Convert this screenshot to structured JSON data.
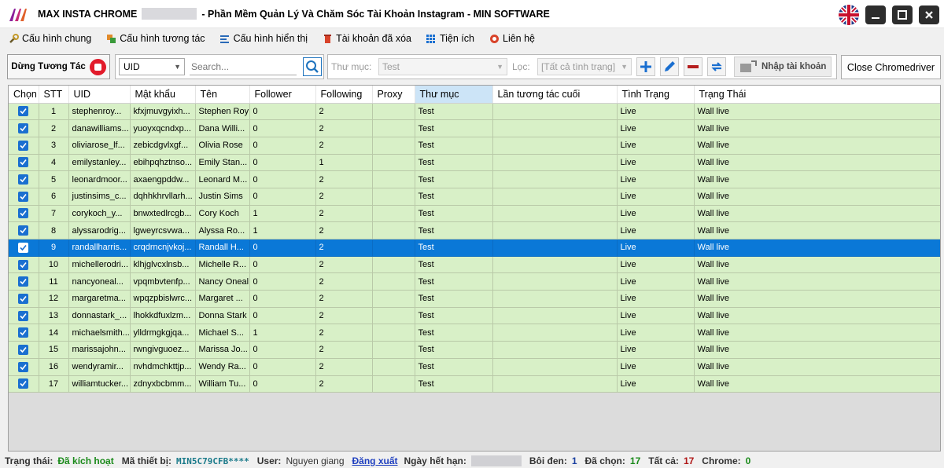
{
  "window": {
    "title_prefix": "MAX INSTA CHROME",
    "title_suffix": "- Phần Mềm Quản Lý Và Chăm Sóc Tài Khoản Instagram - MIN SOFTWARE"
  },
  "menu": {
    "items": [
      {
        "label": "Cấu hình chung",
        "icon": "wrench-icon"
      },
      {
        "label": "Cấu hình tương tác",
        "icon": "interaction-icon"
      },
      {
        "label": "Cấu hình hiển thị",
        "icon": "display-icon"
      },
      {
        "label": "Tài khoản đã xóa",
        "icon": "trash-icon"
      },
      {
        "label": "Tiện ích",
        "icon": "grid-icon"
      },
      {
        "label": "Liên hệ",
        "icon": "contact-icon"
      }
    ]
  },
  "toolbar": {
    "stop_label": "Dừng Tương Tác",
    "search_field_value": "UID",
    "search_placeholder": "Search...",
    "folder_label": "Thư mục:",
    "folder_value": "Test",
    "filter_label": "Lọc:",
    "filter_value": "[Tất cả tình trạng]",
    "import_label": "Nhập tài khoản",
    "close_driver_label": "Close Chromedriver"
  },
  "table": {
    "columns": [
      "Chọn",
      "STT",
      "UID",
      "Mật khẩu",
      "Tên",
      "Follower",
      "Following",
      "Proxy",
      "Thư mục",
      "Lần tương tác cuối",
      "Tình Trạng",
      "Trạng Thái"
    ],
    "selected_row_index": 8,
    "rows": [
      {
        "stt": "1",
        "uid": "stephenroy...",
        "pass": "kfxjmuvgyixh...",
        "name": "Stephen Roy",
        "follower": "0",
        "following": "2",
        "proxy": "",
        "folder": "Test",
        "last": "",
        "status": "Live",
        "state": "Wall live"
      },
      {
        "stt": "2",
        "uid": "danawilliams...",
        "pass": "yuoyxqcndxp...",
        "name": "Dana Willi...",
        "follower": "0",
        "following": "2",
        "proxy": "",
        "folder": "Test",
        "last": "",
        "status": "Live",
        "state": "Wall live"
      },
      {
        "stt": "3",
        "uid": "oliviarose_lf...",
        "pass": "zebicdgvlxgf...",
        "name": "Olivia Rose",
        "follower": "0",
        "following": "2",
        "proxy": "",
        "folder": "Test",
        "last": "",
        "status": "Live",
        "state": "Wall live"
      },
      {
        "stt": "4",
        "uid": "emilystanley...",
        "pass": "ebihpqhztnso...",
        "name": "Emily Stan...",
        "follower": "0",
        "following": "1",
        "proxy": "",
        "folder": "Test",
        "last": "",
        "status": "Live",
        "state": "Wall live"
      },
      {
        "stt": "5",
        "uid": "leonardmoor...",
        "pass": "axaengpddw...",
        "name": "Leonard M...",
        "follower": "0",
        "following": "2",
        "proxy": "",
        "folder": "Test",
        "last": "",
        "status": "Live",
        "state": "Wall live"
      },
      {
        "stt": "6",
        "uid": "justinsims_c...",
        "pass": "dqhhkhrvllarh...",
        "name": "Justin Sims",
        "follower": "0",
        "following": "2",
        "proxy": "",
        "folder": "Test",
        "last": "",
        "status": "Live",
        "state": "Wall live"
      },
      {
        "stt": "7",
        "uid": "corykoch_y...",
        "pass": "bnwxtedlrcgb...",
        "name": "Cory Koch",
        "follower": "1",
        "following": "2",
        "proxy": "",
        "folder": "Test",
        "last": "",
        "status": "Live",
        "state": "Wall live"
      },
      {
        "stt": "8",
        "uid": "alyssarodrig...",
        "pass": "lgweyrcsvwa...",
        "name": "Alyssa Ro...",
        "follower": "1",
        "following": "2",
        "proxy": "",
        "folder": "Test",
        "last": "",
        "status": "Live",
        "state": "Wall live"
      },
      {
        "stt": "9",
        "uid": "randallharris...",
        "pass": "crqdrncnjvkoj...",
        "name": "Randall H...",
        "follower": "0",
        "following": "2",
        "proxy": "",
        "folder": "Test",
        "last": "",
        "status": "Live",
        "state": "Wall live"
      },
      {
        "stt": "10",
        "uid": "michellerodri...",
        "pass": "klhjglvcxlnsb...",
        "name": "Michelle R...",
        "follower": "0",
        "following": "2",
        "proxy": "",
        "folder": "Test",
        "last": "",
        "status": "Live",
        "state": "Wall live"
      },
      {
        "stt": "11",
        "uid": "nancyoneal...",
        "pass": "vpqmbvtenfp...",
        "name": "Nancy Oneal",
        "follower": "0",
        "following": "2",
        "proxy": "",
        "folder": "Test",
        "last": "",
        "status": "Live",
        "state": "Wall live"
      },
      {
        "stt": "12",
        "uid": "margaretma...",
        "pass": "wpqzpbislwrc...",
        "name": "Margaret ...",
        "follower": "0",
        "following": "2",
        "proxy": "",
        "folder": "Test",
        "last": "",
        "status": "Live",
        "state": "Wall live"
      },
      {
        "stt": "13",
        "uid": "donnastark_...",
        "pass": "lhokkdfuxlzm...",
        "name": "Donna Stark",
        "follower": "0",
        "following": "2",
        "proxy": "",
        "folder": "Test",
        "last": "",
        "status": "Live",
        "state": "Wall live"
      },
      {
        "stt": "14",
        "uid": "michaelsmith...",
        "pass": "ylldrmgkgjqa...",
        "name": "Michael S...",
        "follower": "1",
        "following": "2",
        "proxy": "",
        "folder": "Test",
        "last": "",
        "status": "Live",
        "state": "Wall live"
      },
      {
        "stt": "15",
        "uid": "marissajohn...",
        "pass": "rwngivguoez...",
        "name": "Marissa Jo...",
        "follower": "0",
        "following": "2",
        "proxy": "",
        "folder": "Test",
        "last": "",
        "status": "Live",
        "state": "Wall live"
      },
      {
        "stt": "16",
        "uid": "wendyramir...",
        "pass": "nvhdmchkttjp...",
        "name": "Wendy Ra...",
        "follower": "0",
        "following": "2",
        "proxy": "",
        "folder": "Test",
        "last": "",
        "status": "Live",
        "state": "Wall live"
      },
      {
        "stt": "17",
        "uid": "williamtucker...",
        "pass": "zdnyxbcbmm...",
        "name": "William Tu...",
        "follower": "0",
        "following": "2",
        "proxy": "",
        "folder": "Test",
        "last": "",
        "status": "Live",
        "state": "Wall live"
      }
    ]
  },
  "status": {
    "state_label": "Trạng thái:",
    "state_value": "Đã kích hoạt",
    "device_label": "Mã thiết bị:",
    "device_value": "MIN5C79CFB****",
    "user_label": "User:",
    "user_value": "Nguyen giang",
    "logout_label": "Đăng xuất",
    "expiry_label": "Ngày hết hạn:",
    "highlight_label": "Bôi đen:",
    "highlight_value": "1",
    "chosen_label": "Đã chọn:",
    "chosen_value": "17",
    "total_label": "Tất cả:",
    "total_value": "17",
    "chrome_label": "Chrome:",
    "chrome_value": "0"
  },
  "colors": {
    "row_bg": "#d8f0c7",
    "selected_row_bg": "#0a78d7",
    "stop_red": "#e21b2b",
    "accent_blue": "#1a6fd0"
  }
}
